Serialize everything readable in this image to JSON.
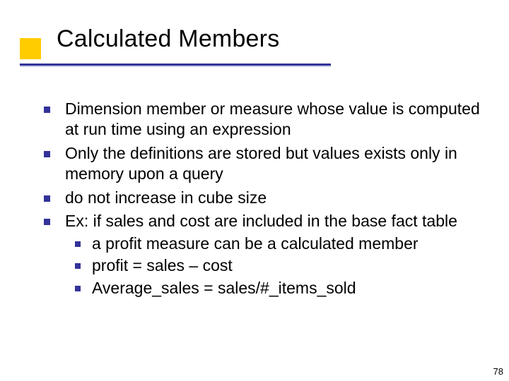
{
  "slide": {
    "title": "Calculated Members",
    "bullets": [
      {
        "text": "Dimension member or measure whose value is computed at run time using an expression"
      },
      {
        "text": "Only the definitions are stored but values exists only in memory upon a query"
      },
      {
        "text": "do not increase in cube size"
      },
      {
        "text": "Ex: if sales and cost are included in the base fact table",
        "sub": [
          "a profit measure can be a calculated member",
          "profit = sales – cost",
          "Average_sales = sales/#_items_sold"
        ]
      }
    ],
    "page_number": "78"
  }
}
